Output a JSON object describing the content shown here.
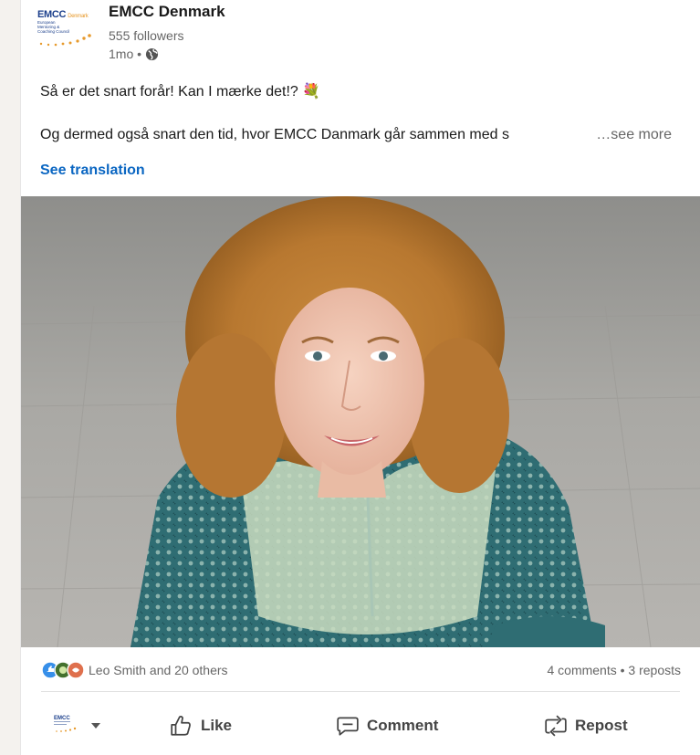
{
  "post": {
    "author": "EMCC Denmark",
    "logo": {
      "line1": "EMCC",
      "line1b": "Denmark",
      "line2": "European Mentoring & Coaching Council"
    },
    "followers": "555 followers",
    "time": "1mo •",
    "text_line1": "Så er det snart forår! Kan I mærke det!? 💐",
    "text_line2": "Og dermed også snart den tid, hvor EMCC Danmark går sammen med s",
    "see_more": "…see more",
    "see_translation": "See translation"
  },
  "social": {
    "reactors": "Leo Smith and 20 others",
    "counts": "4 comments • 3 reposts"
  },
  "actions": {
    "like": "Like",
    "comment": "Comment",
    "repost": "Repost"
  },
  "icons": [
    "globe-icon",
    "like-icon",
    "comment-icon",
    "repost-icon",
    "chevron-down-icon"
  ],
  "colors": {
    "link": "#0a66c2",
    "muted": "#666666"
  }
}
